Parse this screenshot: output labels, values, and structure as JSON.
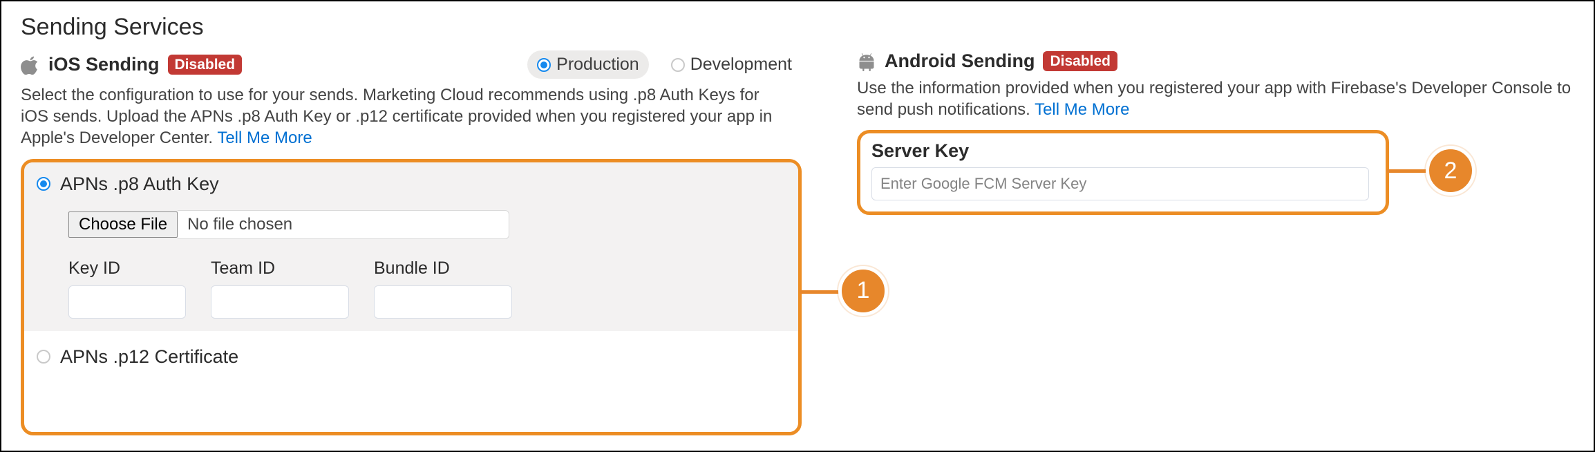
{
  "page": {
    "title": "Sending Services"
  },
  "ios": {
    "title": "iOS Sending",
    "badge": "Disabled",
    "env": {
      "production": "Production",
      "development": "Development",
      "selected": "production"
    },
    "desc": "Select the configuration to use for your sends. Marketing Cloud recommends using .p8 Auth Keys for iOS sends. Upload the APNs .p8 Auth Key or .p12 certificate provided when you registered your app in Apple's Developer Center. ",
    "tell_more": "Tell Me More",
    "option_p8": "APNs .p8 Auth Key",
    "option_p12": "APNs .p12 Certificate",
    "choose_file": "Choose File",
    "file_status": "No file chosen",
    "key_id_label": "Key ID",
    "team_id_label": "Team ID",
    "bundle_id_label": "Bundle ID"
  },
  "android": {
    "title": "Android Sending",
    "badge": "Disabled",
    "desc": "Use the information provided when you registered your app with Firebase's Developer Console to send push notifications. ",
    "tell_more": "Tell Me More",
    "server_key_label": "Server Key",
    "server_key_placeholder": "Enter Google FCM Server Key"
  },
  "annotations": {
    "n1": "1",
    "n2": "2"
  },
  "colors": {
    "accent": "#0070d2",
    "danger": "#c23934",
    "highlight": "#ec8d24"
  }
}
